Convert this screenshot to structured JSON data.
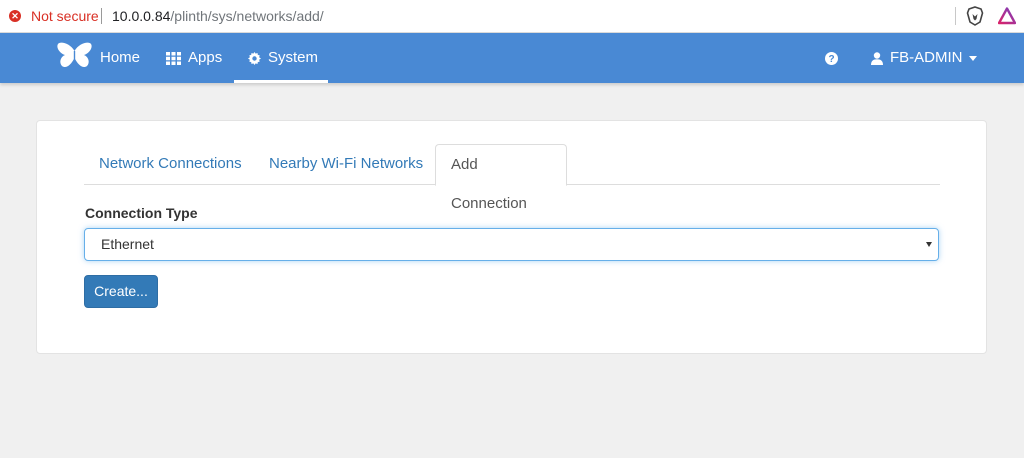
{
  "browser": {
    "security_label": "Not secure",
    "url_host": "10.0.0.84",
    "url_path": "/plinth/sys/networks/add/"
  },
  "navbar": {
    "home_label": "Home",
    "apps_label": "Apps",
    "system_label": "System",
    "user_label": "FB-ADMIN",
    "accent_color": "#4989d4"
  },
  "tabs": [
    {
      "label": "Network Connections"
    },
    {
      "label": "Nearby Wi-Fi Networks"
    },
    {
      "label": "Add Connection"
    }
  ],
  "form": {
    "connection_type_label": "Connection Type",
    "connection_type_value": "Ethernet",
    "create_button_label": "Create..."
  }
}
